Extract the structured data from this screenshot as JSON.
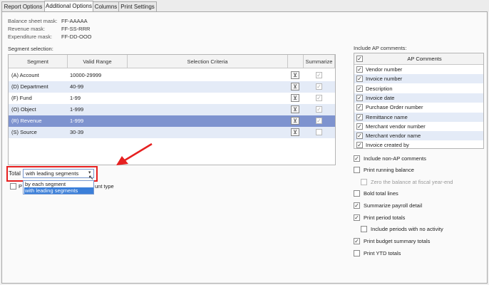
{
  "tabs": [
    "Report Options",
    "Additional Options",
    "Columns",
    "Print Settings"
  ],
  "masks": [
    {
      "label": "Balance sheet mask:",
      "value": "FF-AAAAA"
    },
    {
      "label": "Revenue mask:",
      "value": "FF-SS-RRR"
    },
    {
      "label": "Expenditure mask:",
      "value": "FF-DD-OOO"
    }
  ],
  "segment_selection": {
    "label": "Segment selection:",
    "headers": [
      "Segment",
      "Valid Range",
      "Selection Criteria",
      "Summarize"
    ],
    "rows": [
      {
        "segment": "(A) Account",
        "range": "10000-29999",
        "criteria": "",
        "summarize": true
      },
      {
        "segment": "(D) Department",
        "range": "40-99",
        "criteria": "",
        "summarize": true
      },
      {
        "segment": "(F) Fund",
        "range": "1-99",
        "criteria": "",
        "summarize": true
      },
      {
        "segment": "(O) Object",
        "range": "1-999",
        "criteria": "",
        "summarize": true
      },
      {
        "segment": "(R) Revenue",
        "range": "1-999",
        "criteria": "",
        "summarize": true
      },
      {
        "segment": "(S) Source",
        "range": "30-39",
        "criteria": "",
        "summarize": false
      }
    ]
  },
  "total": {
    "label": "Total",
    "selected": "with leading segments",
    "options": [
      "by each segment",
      "with leading segments"
    ]
  },
  "hidden_option_tail": "unt type",
  "ap_comments": {
    "label": "Include AP comments:",
    "header": "AP Comments",
    "items": [
      {
        "label": "Vendor number",
        "checked": true
      },
      {
        "label": "Invoice number",
        "checked": true
      },
      {
        "label": "Description",
        "checked": true
      },
      {
        "label": "Invoice date",
        "checked": true
      },
      {
        "label": "Purchase Order number",
        "checked": true
      },
      {
        "label": "Remittance name",
        "checked": true
      },
      {
        "label": "Merchant vendor number",
        "checked": true
      },
      {
        "label": "Merchant vendor name",
        "checked": true
      },
      {
        "label": "Invoice created by",
        "checked": true
      }
    ]
  },
  "options": [
    {
      "label": "Include non-AP comments",
      "checked": true
    },
    {
      "label": "Print running balance",
      "checked": false
    },
    {
      "label": "Zero the balance at fiscal year-end",
      "checked": false
    },
    {
      "label": "Bold total lines",
      "checked": false
    },
    {
      "label": "Summarize payroll detail",
      "checked": true
    },
    {
      "label": "Print period totals",
      "checked": true
    },
    {
      "label": "Include periods with no activity",
      "checked": false
    },
    {
      "label": "Print budget summary totals",
      "checked": true
    },
    {
      "label": "Print YTD totals",
      "checked": false
    }
  ],
  "colors": {
    "highlight": "#e62020",
    "selected_row": "#7e93cf",
    "alt_row": "#e4ebf7",
    "dropdown_sel": "#3b7fd9"
  }
}
